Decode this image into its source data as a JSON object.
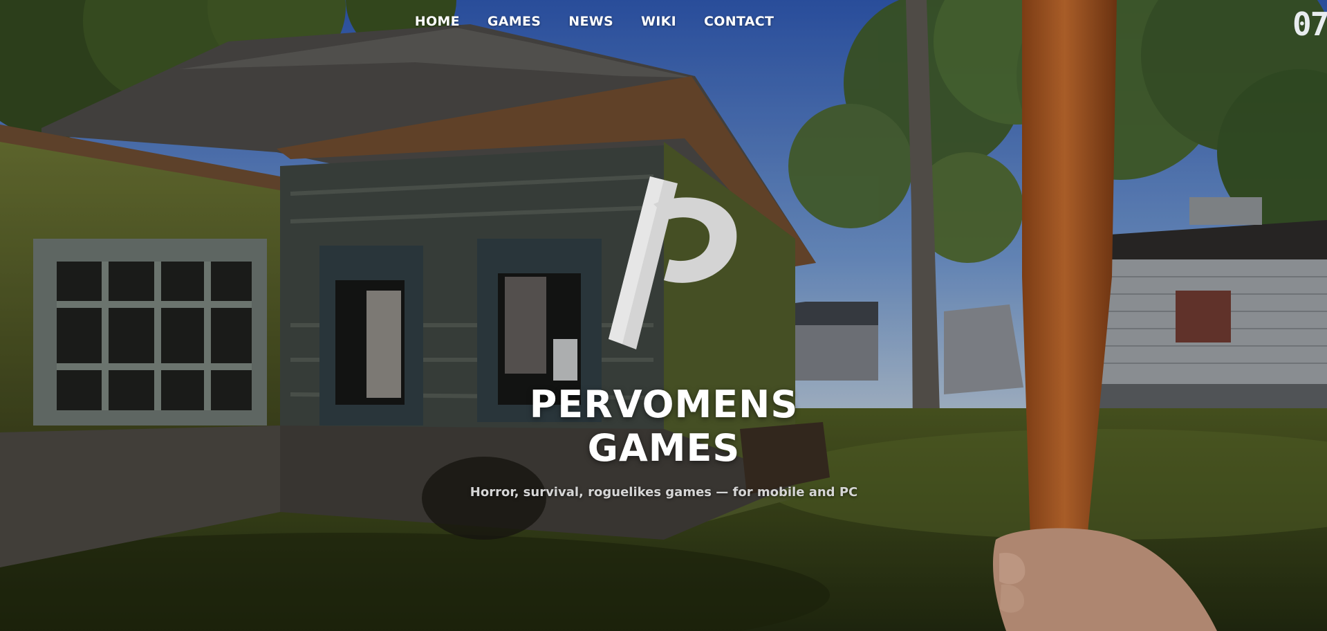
{
  "nav": {
    "items": [
      {
        "label": "HOME"
      },
      {
        "label": "GAMES"
      },
      {
        "label": "NEWS"
      },
      {
        "label": "WIKI"
      },
      {
        "label": "CONTACT"
      }
    ]
  },
  "hero": {
    "title": "PERVOMENS GAMES",
    "tagline": "Horror, survival, roguelikes games — for mobile and PC",
    "corner_text": "07",
    "logo_icon": "pervomens-p-logo-icon"
  },
  "colors": {
    "sky": "#4a6fb8",
    "grass": "#3b4a1e",
    "house_wall": "#5e6a2c",
    "roof": "#3e3a36",
    "bat": "#b8612a",
    "hand": "#c89a80",
    "text": "#ffffff"
  }
}
